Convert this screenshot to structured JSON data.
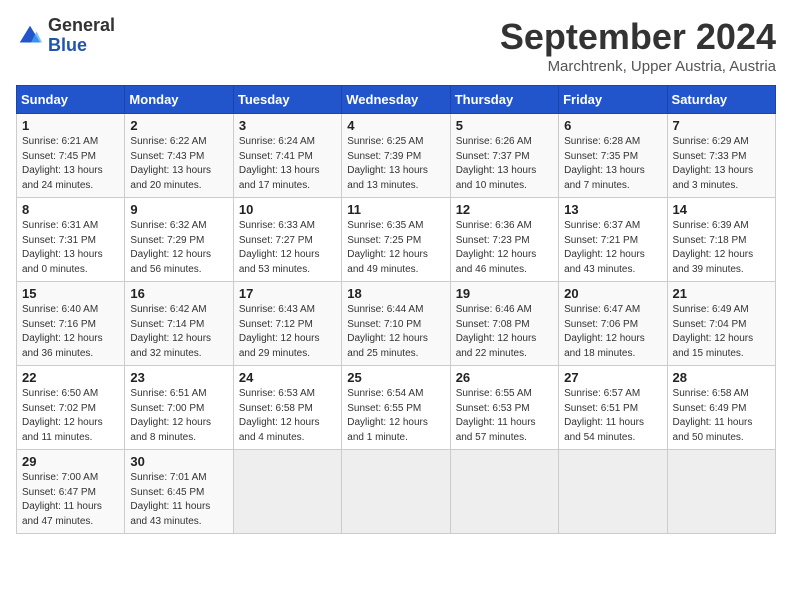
{
  "header": {
    "logo_line1": "General",
    "logo_line2": "Blue",
    "month_title": "September 2024",
    "location": "Marchtrenk, Upper Austria, Austria"
  },
  "weekdays": [
    "Sunday",
    "Monday",
    "Tuesday",
    "Wednesday",
    "Thursday",
    "Friday",
    "Saturday"
  ],
  "weeks": [
    [
      {
        "day": "1",
        "info": "Sunrise: 6:21 AM\nSunset: 7:45 PM\nDaylight: 13 hours\nand 24 minutes."
      },
      {
        "day": "2",
        "info": "Sunrise: 6:22 AM\nSunset: 7:43 PM\nDaylight: 13 hours\nand 20 minutes."
      },
      {
        "day": "3",
        "info": "Sunrise: 6:24 AM\nSunset: 7:41 PM\nDaylight: 13 hours\nand 17 minutes."
      },
      {
        "day": "4",
        "info": "Sunrise: 6:25 AM\nSunset: 7:39 PM\nDaylight: 13 hours\nand 13 minutes."
      },
      {
        "day": "5",
        "info": "Sunrise: 6:26 AM\nSunset: 7:37 PM\nDaylight: 13 hours\nand 10 minutes."
      },
      {
        "day": "6",
        "info": "Sunrise: 6:28 AM\nSunset: 7:35 PM\nDaylight: 13 hours\nand 7 minutes."
      },
      {
        "day": "7",
        "info": "Sunrise: 6:29 AM\nSunset: 7:33 PM\nDaylight: 13 hours\nand 3 minutes."
      }
    ],
    [
      {
        "day": "8",
        "info": "Sunrise: 6:31 AM\nSunset: 7:31 PM\nDaylight: 13 hours\nand 0 minutes."
      },
      {
        "day": "9",
        "info": "Sunrise: 6:32 AM\nSunset: 7:29 PM\nDaylight: 12 hours\nand 56 minutes."
      },
      {
        "day": "10",
        "info": "Sunrise: 6:33 AM\nSunset: 7:27 PM\nDaylight: 12 hours\nand 53 minutes."
      },
      {
        "day": "11",
        "info": "Sunrise: 6:35 AM\nSunset: 7:25 PM\nDaylight: 12 hours\nand 49 minutes."
      },
      {
        "day": "12",
        "info": "Sunrise: 6:36 AM\nSunset: 7:23 PM\nDaylight: 12 hours\nand 46 minutes."
      },
      {
        "day": "13",
        "info": "Sunrise: 6:37 AM\nSunset: 7:21 PM\nDaylight: 12 hours\nand 43 minutes."
      },
      {
        "day": "14",
        "info": "Sunrise: 6:39 AM\nSunset: 7:18 PM\nDaylight: 12 hours\nand 39 minutes."
      }
    ],
    [
      {
        "day": "15",
        "info": "Sunrise: 6:40 AM\nSunset: 7:16 PM\nDaylight: 12 hours\nand 36 minutes."
      },
      {
        "day": "16",
        "info": "Sunrise: 6:42 AM\nSunset: 7:14 PM\nDaylight: 12 hours\nand 32 minutes."
      },
      {
        "day": "17",
        "info": "Sunrise: 6:43 AM\nSunset: 7:12 PM\nDaylight: 12 hours\nand 29 minutes."
      },
      {
        "day": "18",
        "info": "Sunrise: 6:44 AM\nSunset: 7:10 PM\nDaylight: 12 hours\nand 25 minutes."
      },
      {
        "day": "19",
        "info": "Sunrise: 6:46 AM\nSunset: 7:08 PM\nDaylight: 12 hours\nand 22 minutes."
      },
      {
        "day": "20",
        "info": "Sunrise: 6:47 AM\nSunset: 7:06 PM\nDaylight: 12 hours\nand 18 minutes."
      },
      {
        "day": "21",
        "info": "Sunrise: 6:49 AM\nSunset: 7:04 PM\nDaylight: 12 hours\nand 15 minutes."
      }
    ],
    [
      {
        "day": "22",
        "info": "Sunrise: 6:50 AM\nSunset: 7:02 PM\nDaylight: 12 hours\nand 11 minutes."
      },
      {
        "day": "23",
        "info": "Sunrise: 6:51 AM\nSunset: 7:00 PM\nDaylight: 12 hours\nand 8 minutes."
      },
      {
        "day": "24",
        "info": "Sunrise: 6:53 AM\nSunset: 6:58 PM\nDaylight: 12 hours\nand 4 minutes."
      },
      {
        "day": "25",
        "info": "Sunrise: 6:54 AM\nSunset: 6:55 PM\nDaylight: 12 hours\nand 1 minute."
      },
      {
        "day": "26",
        "info": "Sunrise: 6:55 AM\nSunset: 6:53 PM\nDaylight: 11 hours\nand 57 minutes."
      },
      {
        "day": "27",
        "info": "Sunrise: 6:57 AM\nSunset: 6:51 PM\nDaylight: 11 hours\nand 54 minutes."
      },
      {
        "day": "28",
        "info": "Sunrise: 6:58 AM\nSunset: 6:49 PM\nDaylight: 11 hours\nand 50 minutes."
      }
    ],
    [
      {
        "day": "29",
        "info": "Sunrise: 7:00 AM\nSunset: 6:47 PM\nDaylight: 11 hours\nand 47 minutes."
      },
      {
        "day": "30",
        "info": "Sunrise: 7:01 AM\nSunset: 6:45 PM\nDaylight: 11 hours\nand 43 minutes."
      },
      {
        "day": "",
        "info": ""
      },
      {
        "day": "",
        "info": ""
      },
      {
        "day": "",
        "info": ""
      },
      {
        "day": "",
        "info": ""
      },
      {
        "day": "",
        "info": ""
      }
    ]
  ]
}
